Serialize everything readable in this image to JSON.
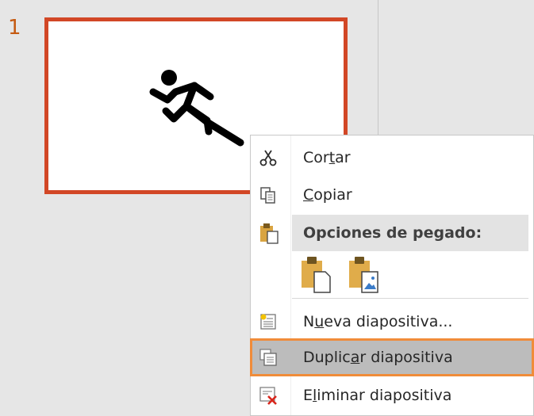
{
  "slide_panel": {
    "slide_number": "1"
  },
  "context_menu": {
    "items": [
      {
        "id": "cut",
        "pre": "Cor",
        "key": "t",
        "post": "ar",
        "icon": "scissors-icon"
      },
      {
        "id": "copy",
        "pre": "",
        "key": "C",
        "post": "opiar",
        "icon": "copy-icon"
      },
      {
        "id": "paste_header",
        "label": "Opciones de pegado:",
        "icon": "clipboard-icon"
      },
      {
        "id": "new_slide",
        "pre": "N",
        "key": "u",
        "post": "eva diapositiva...",
        "icon": "new-slide-icon"
      },
      {
        "id": "duplicate_slide",
        "pre": "Duplic",
        "key": "a",
        "post": "r diapositiva",
        "icon": "duplicate-slide-icon"
      },
      {
        "id": "delete_slide",
        "pre": "E",
        "key": "l",
        "post": "iminar diapositiva",
        "icon": "delete-slide-icon"
      }
    ],
    "paste_options": [
      {
        "name": "keep-source-formatting-paste-icon"
      },
      {
        "name": "paste-as-picture-icon"
      }
    ]
  },
  "colors": {
    "slide_border": "#d24726",
    "slide_number": "#c55a11",
    "highlight_outline": "#f08c3a",
    "highlight_fill": "#bcbcbc"
  }
}
